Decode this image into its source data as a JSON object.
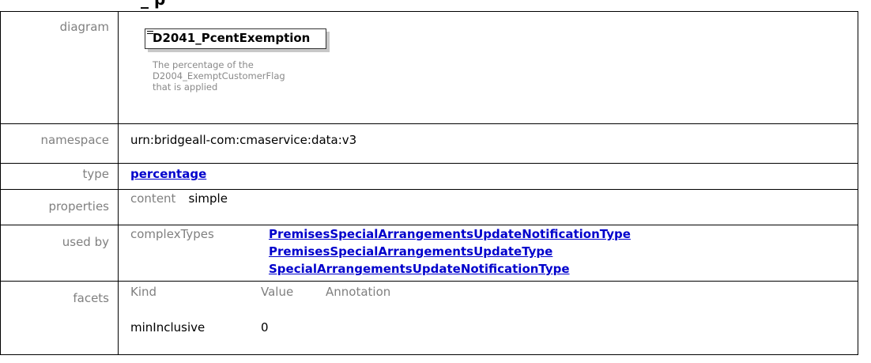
{
  "header": {
    "title_fragment": "_  p"
  },
  "rows": {
    "diagram": {
      "label": "diagram",
      "element_name": "D2041_PcentExemption",
      "doc_lines": [
        "The percentage of the",
        "D2004_ExemptCustomerFlag",
        "that is applied"
      ]
    },
    "namespace": {
      "label": "namespace",
      "value": "urn:bridgeall-com:cmaservice:data:v3"
    },
    "type": {
      "label": "type",
      "value": "percentage"
    },
    "properties": {
      "label": "properties",
      "key": "content",
      "value": "simple"
    },
    "used_by": {
      "label": "used by",
      "key": "complexTypes",
      "links": [
        "PremisesSpecialArrangementsUpdateNotificationType",
        "PremisesSpecialArrangementsUpdateType",
        "SpecialArrangementsUpdateNotificationType"
      ]
    },
    "facets": {
      "label": "facets",
      "headers": [
        "Kind",
        "Value",
        "Annotation"
      ],
      "rows": [
        {
          "kind": "minInclusive",
          "value": "0",
          "annotation": ""
        }
      ]
    }
  },
  "colors": {
    "link": "#0000cc",
    "label_gray": "#808080",
    "doc_gray": "#8a8a8a",
    "border": "#000000"
  }
}
